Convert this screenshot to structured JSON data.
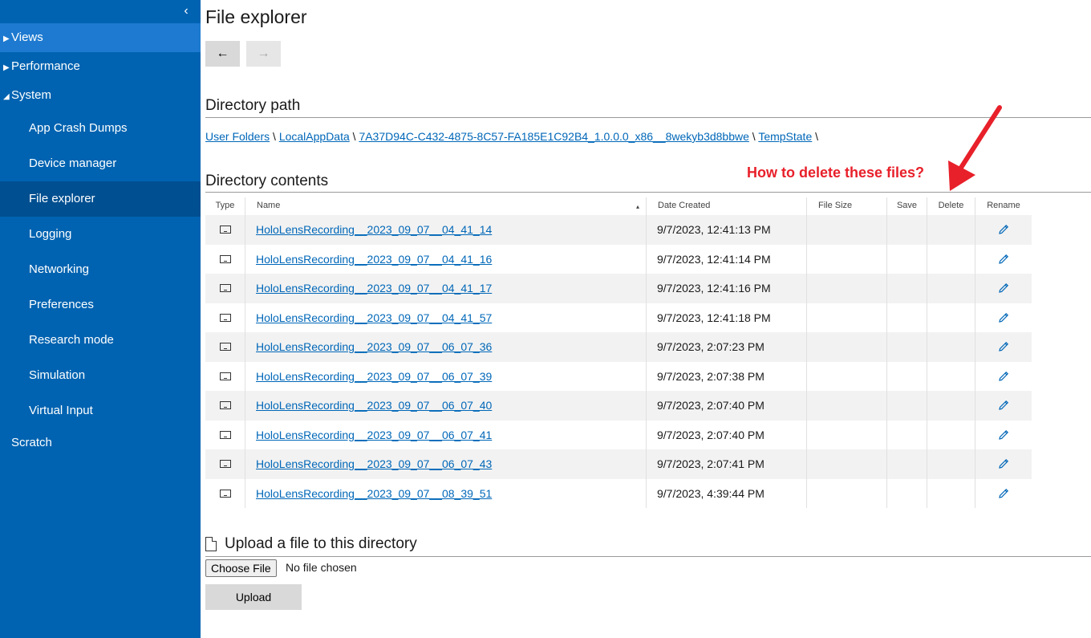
{
  "sidebar": {
    "collapse_glyph": "‹",
    "top_items": [
      {
        "caret": "▶",
        "label": "Views"
      },
      {
        "caret": "▶",
        "label": "Performance"
      },
      {
        "caret": "◢",
        "label": "System"
      }
    ],
    "sub_items": [
      {
        "label": "App Crash Dumps"
      },
      {
        "label": "Device manager"
      },
      {
        "label": "File explorer"
      },
      {
        "label": "Logging"
      },
      {
        "label": "Networking"
      },
      {
        "label": "Preferences"
      },
      {
        "label": "Research mode"
      },
      {
        "label": "Simulation"
      },
      {
        "label": "Virtual Input"
      }
    ],
    "scratch_label": "Scratch"
  },
  "main": {
    "title": "File explorer",
    "back_glyph": "←",
    "forward_glyph": "→",
    "path_heading": "Directory path",
    "path": [
      {
        "label": "User Folders"
      },
      {
        "label": "LocalAppData"
      },
      {
        "label": "7A37D94C-C432-4875-8C57-FA185E1C92B4_1.0.0.0_x86__8wekyb3d8bbwe"
      },
      {
        "label": "TempState"
      }
    ],
    "path_sep": "\\",
    "contents_heading": "Directory contents",
    "annotation": "How to delete these files?",
    "columns": {
      "type": "Type",
      "name": "Name",
      "sort_glyph": "▴",
      "date": "Date Created",
      "size": "File Size",
      "save": "Save",
      "delete": "Delete",
      "rename": "Rename"
    },
    "files": [
      {
        "name": "HoloLensRecording__2023_09_07__04_41_14",
        "date": "9/7/2023, 12:41:13 PM"
      },
      {
        "name": "HoloLensRecording__2023_09_07__04_41_16",
        "date": "9/7/2023, 12:41:14 PM"
      },
      {
        "name": "HoloLensRecording__2023_09_07__04_41_17",
        "date": "9/7/2023, 12:41:16 PM"
      },
      {
        "name": "HoloLensRecording__2023_09_07__04_41_57",
        "date": "9/7/2023, 12:41:18 PM"
      },
      {
        "name": "HoloLensRecording__2023_09_07__06_07_36",
        "date": "9/7/2023, 2:07:23 PM"
      },
      {
        "name": "HoloLensRecording__2023_09_07__06_07_39",
        "date": "9/7/2023, 2:07:38 PM"
      },
      {
        "name": "HoloLensRecording__2023_09_07__06_07_40",
        "date": "9/7/2023, 2:07:40 PM"
      },
      {
        "name": "HoloLensRecording__2023_09_07__06_07_41",
        "date": "9/7/2023, 2:07:40 PM"
      },
      {
        "name": "HoloLensRecording__2023_09_07__06_07_43",
        "date": "9/7/2023, 2:07:41 PM"
      },
      {
        "name": "HoloLensRecording__2023_09_07__08_39_51",
        "date": "9/7/2023, 4:39:44 PM"
      }
    ],
    "upload_heading": "Upload a file to this directory",
    "choose_file_label": "Choose File",
    "no_file_text": "No file chosen",
    "upload_label": "Upload"
  },
  "colors": {
    "sidebar_bg": "#0063b1",
    "selected_bg": "#004f91",
    "link": "#0067b8",
    "annotation": "#e8202a"
  }
}
